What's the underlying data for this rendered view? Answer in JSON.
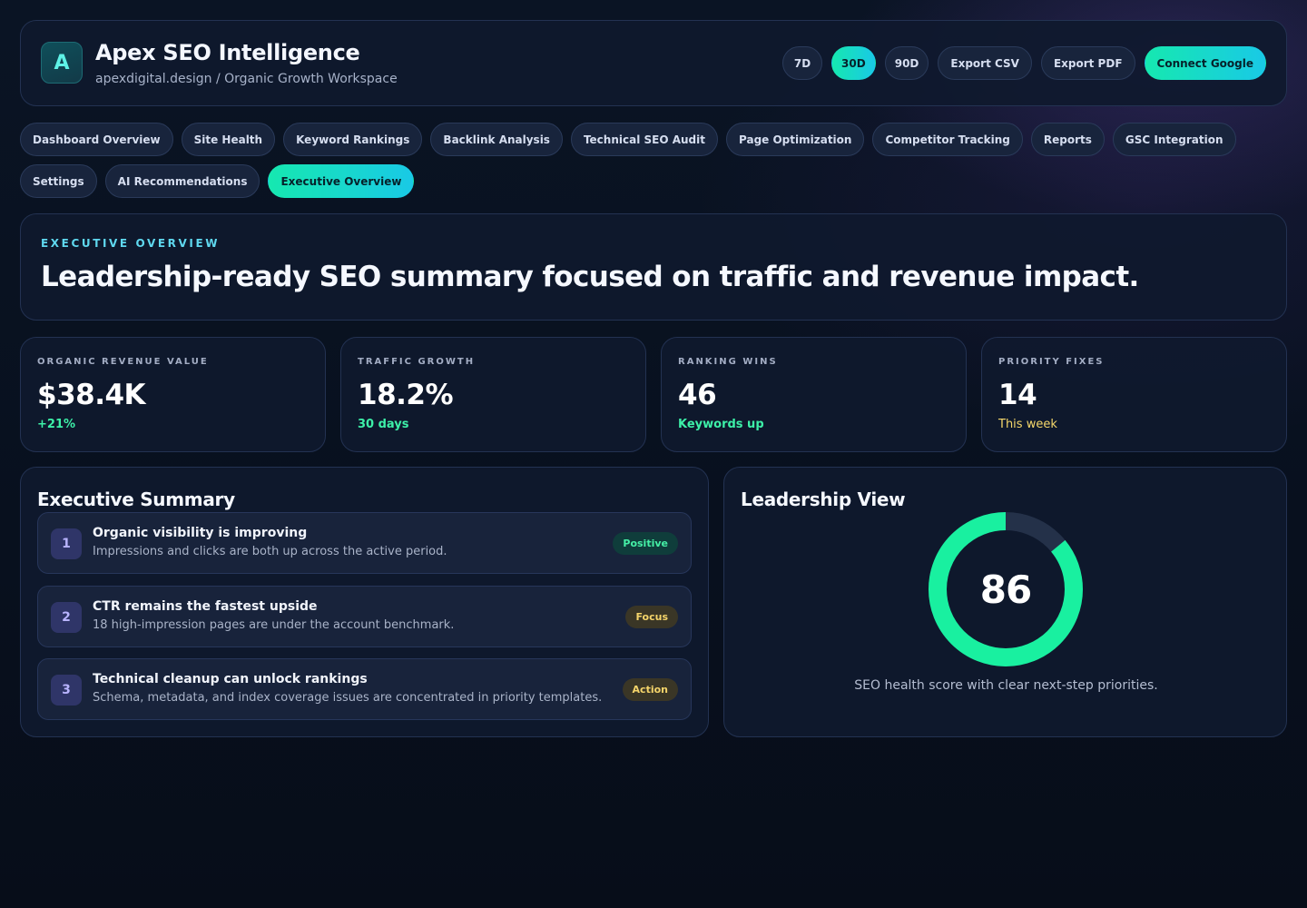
{
  "header": {
    "logo_letter": "A",
    "title": "Apex SEO Intelligence",
    "subtitle": "apexdigital.design / Organic Growth Workspace",
    "ranges": [
      {
        "label": "7D",
        "active": false
      },
      {
        "label": "30D",
        "active": true
      },
      {
        "label": "90D",
        "active": false
      }
    ],
    "export_csv": "Export CSV",
    "export_pdf": "Export PDF",
    "connect": "Connect Google"
  },
  "nav": {
    "tabs": [
      {
        "label": "Dashboard Overview",
        "active": false
      },
      {
        "label": "Site Health",
        "active": false
      },
      {
        "label": "Keyword Rankings",
        "active": false
      },
      {
        "label": "Backlink Analysis",
        "active": false
      },
      {
        "label": "Technical SEO Audit",
        "active": false
      },
      {
        "label": "Page Optimization",
        "active": false
      },
      {
        "label": "Competitor Tracking",
        "active": false
      },
      {
        "label": "Reports",
        "active": false
      },
      {
        "label": "GSC Integration",
        "active": false
      },
      {
        "label": "Settings",
        "active": false
      },
      {
        "label": "AI Recommendations",
        "active": false
      },
      {
        "label": "Executive Overview",
        "active": true
      }
    ]
  },
  "hero": {
    "eyebrow": "EXECUTIVE OVERVIEW",
    "title": "Leadership-ready SEO summary focused on traffic and revenue impact."
  },
  "kpis": [
    {
      "label": "ORGANIC REVENUE VALUE",
      "value": "$38.4K",
      "delta": "+21%"
    },
    {
      "label": "TRAFFIC GROWTH",
      "value": "18.2%",
      "delta": "30 days"
    },
    {
      "label": "RANKING WINS",
      "value": "46",
      "delta": "Keywords up"
    },
    {
      "label": "PRIORITY FIXES",
      "value": "14",
      "delta": "This week"
    }
  ],
  "summary": {
    "title": "Executive Summary",
    "items": [
      {
        "num": "1",
        "title": "Organic visibility is improving",
        "desc": "Impressions and clicks are both up across the active period.",
        "badge": "Positive"
      },
      {
        "num": "2",
        "title": "CTR remains the fastest upside",
        "desc": "18 high-impression pages are under the account benchmark.",
        "badge": "Focus"
      },
      {
        "num": "3",
        "title": "Technical cleanup can unlock rankings",
        "desc": "Schema, metadata, and index coverage issues are concentrated in priority templates.",
        "badge": "Action"
      }
    ]
  },
  "leadership": {
    "title": "Leadership View",
    "score": "86",
    "score_fraction": 0.86,
    "caption": "SEO health score with clear next-step priorities.",
    "colors": {
      "track": "#243149",
      "fill": "#19f0a0"
    }
  }
}
